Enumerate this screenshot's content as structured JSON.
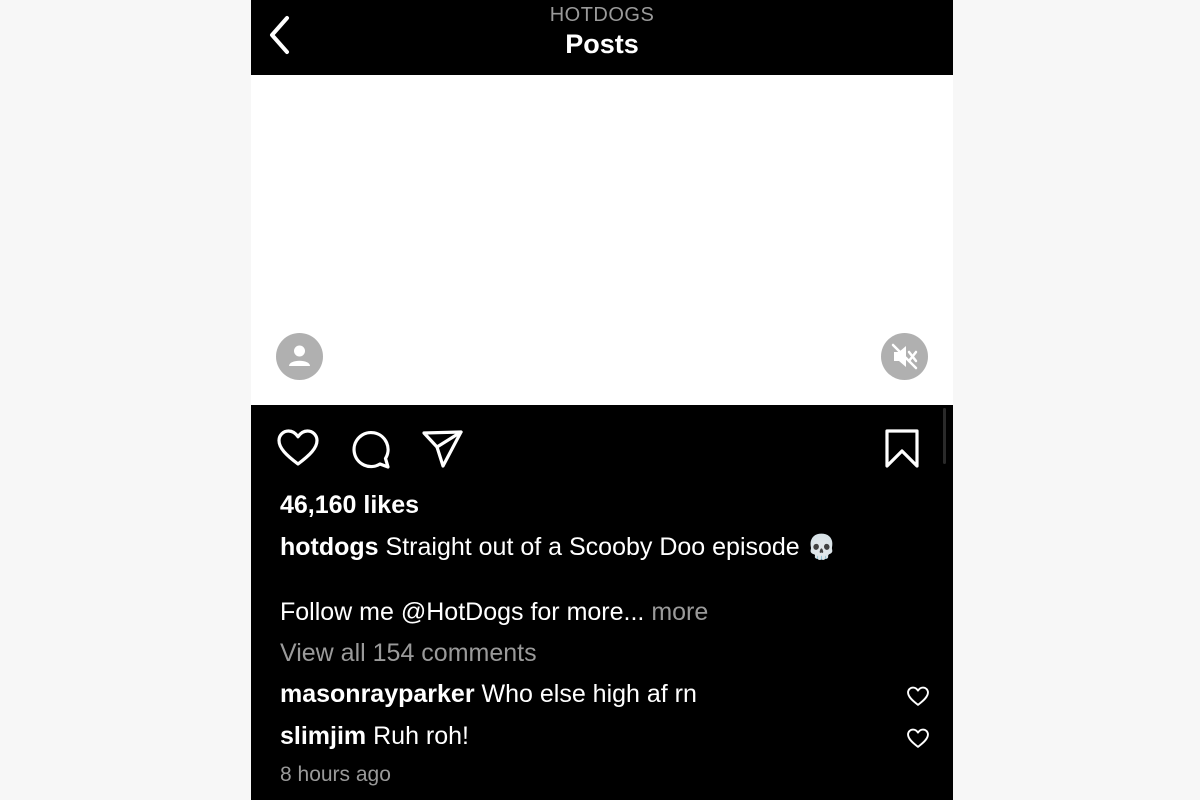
{
  "header": {
    "account_name": "HOTDOGS",
    "title": "Posts",
    "back_icon": "chevron-left-icon"
  },
  "media": {
    "background_color": "#ffffff",
    "avatar_icon": "user-icon",
    "audio_icon": "speaker-muted-icon"
  },
  "actions": {
    "icons": [
      "heart-icon",
      "comment-icon",
      "share-icon",
      "bookmark-icon"
    ]
  },
  "post": {
    "likes": "46,160 likes",
    "author": "hotdogs",
    "caption": "Straight out of a Scooby Doo episode",
    "caption_emoji": "💀",
    "follow_text": "Follow me @HotDogs for more...",
    "more_label": "more",
    "view_comments": "View all 154 comments",
    "timestamp": "8 hours ago"
  },
  "comments": [
    {
      "username": "masonrayparker",
      "text": "Who else high af rn"
    },
    {
      "username": "slimjim",
      "text": "Ruh roh!"
    }
  ],
  "colors": {
    "background": "#000000",
    "text": "#ffffff",
    "secondary_text": "#9a9a9a",
    "overlay_button": "#b0b0b0"
  }
}
